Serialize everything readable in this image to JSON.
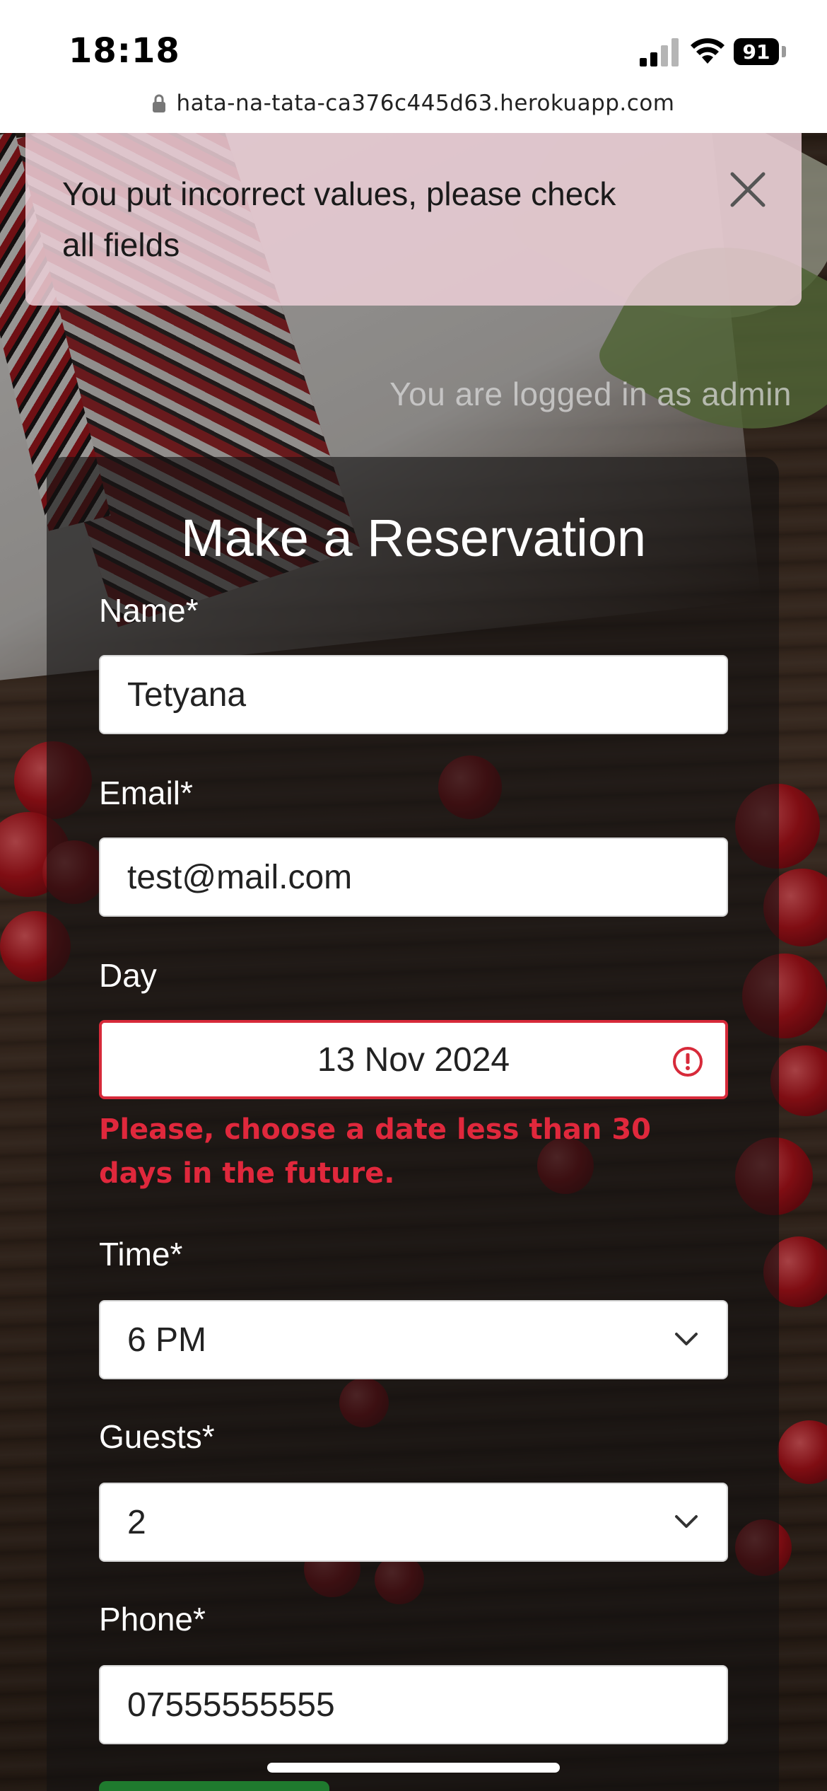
{
  "status_bar": {
    "time": "18:18",
    "battery": "91"
  },
  "browser": {
    "url": "hata-na-tata-ca376c445d63.herokuapp.com"
  },
  "alert": {
    "message": "You put incorrect values, please check all fields"
  },
  "session": {
    "logged_in_text": "You are logged in as admin"
  },
  "form": {
    "title": "Make a Reservation",
    "name": {
      "label": "Name*",
      "value": "Tetyana"
    },
    "email": {
      "label": "Email*",
      "value": "test@mail.com"
    },
    "day": {
      "label": "Day",
      "value": "13 Nov 2024",
      "error": "Please, choose a date less than 30 days in the future."
    },
    "time": {
      "label": "Time*",
      "value": "6 PM"
    },
    "guests": {
      "label": "Guests*",
      "value": "2"
    },
    "phone": {
      "label": "Phone*",
      "value": "07555555555"
    }
  },
  "colors": {
    "error": "#d72a3a",
    "alert_bg": "#ebced6",
    "submit": "#1f7a2e"
  }
}
